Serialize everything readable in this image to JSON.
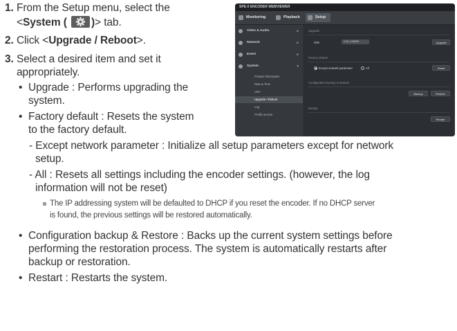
{
  "steps": [
    {
      "number": "1.",
      "line1": "From the Setup menu, select the",
      "line2_prefix": "<",
      "line2_bold": "System (",
      "line2_bold_end": ")",
      "line2_suffix": "> tab.",
      "icon": "gear-icon"
    },
    {
      "number": "2.",
      "prefix": "Click <",
      "bold": "Upgrade / Reboot",
      "suffix": ">."
    },
    {
      "number": "3.",
      "line1": "Select a desired item and set it",
      "line2": "appropriately."
    }
  ],
  "bullets": {
    "upgrade": {
      "line1": "Upgrade : Performs upgrading the",
      "line2": "system."
    },
    "factory": {
      "line1": "Factory default : Resets the system",
      "line2": "to the factory default."
    },
    "except": {
      "line1": "- Except network parameter : Initialize all setup parameters except for network",
      "line2": "setup."
    },
    "all": {
      "line1": "- All : Resets all settings including the encoder settings. (however, the log",
      "line2": "information will not be reset)"
    },
    "note": {
      "line1": "The IP addressing system will be defaulted to DHCP if you reset the encoder. If no DHCP server",
      "line2": "is found, the previous settings will be restored automatically."
    },
    "backup": {
      "line1": "Configuration backup & Restore : Backs up the current system settings before",
      "line2": "performing the restoration process. The system is automatically restarts after",
      "line3": "backup or restoration."
    },
    "restart": {
      "line1": "Restart : Restarts the system."
    }
  },
  "screenshot": {
    "window_title": "SPE-0 ENCODER WEBVIEWER",
    "nav_tabs": [
      "Monitoring",
      "Playback",
      "Setup"
    ],
    "side_menu": [
      {
        "label": "Video & Audio"
      },
      {
        "label": "Network"
      },
      {
        "label": "Event"
      },
      {
        "label": "System"
      }
    ],
    "system_submenu": [
      "Product information",
      "Date & Time",
      "User",
      "Upgrade / Reboot",
      "Log",
      "Profile access"
    ],
    "sections": {
      "upgrade": "Upgrade",
      "factory": "Factory default",
      "backup": "Configuration backup & Restore",
      "restart": "Restart"
    },
    "fields": {
      "sw_label": "S/W",
      "sw_value": "1.00_130625",
      "except_label": "Except network parameter",
      "all_label": "All"
    },
    "buttons": {
      "upgrade": "Upgrade",
      "reset": "Reset",
      "backup": "Backup",
      "restore": "Restore",
      "restart": "Restart"
    }
  },
  "colors": {
    "text": "#333333",
    "screenshot_bg": "#2e3136",
    "icon_bg": "#5d5d5d"
  }
}
